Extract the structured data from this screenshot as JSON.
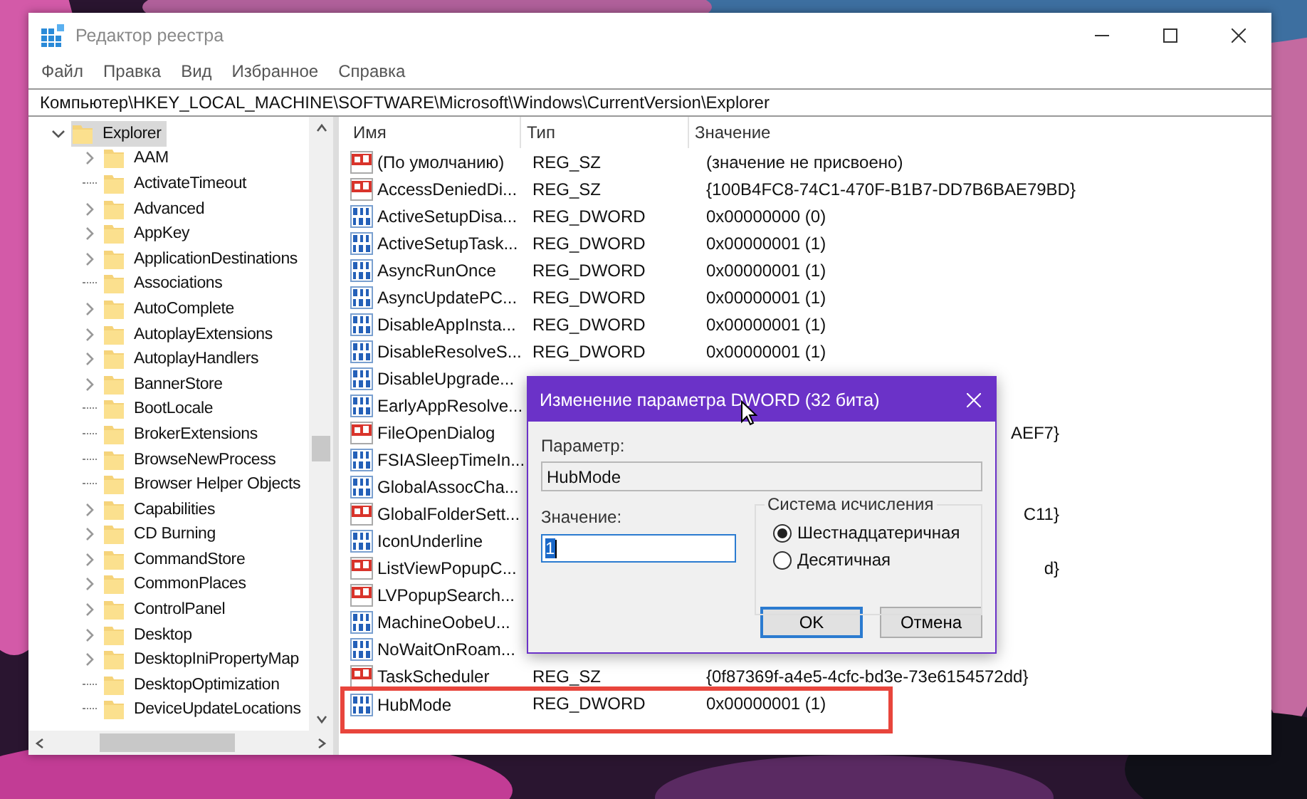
{
  "window": {
    "title": "Редактор реестра"
  },
  "menu": [
    "Файл",
    "Правка",
    "Вид",
    "Избранное",
    "Справка"
  ],
  "address": "Компьютер\\HKEY_LOCAL_MACHINE\\SOFTWARE\\Microsoft\\Windows\\CurrentVersion\\Explorer",
  "tree": [
    {
      "label": "Explorer",
      "expanded": true,
      "selected": true,
      "children": [
        {
          "label": "AAM",
          "expandable": true
        },
        {
          "label": "ActivateTimeout",
          "expandable": false
        },
        {
          "label": "Advanced",
          "expandable": true
        },
        {
          "label": "AppKey",
          "expandable": true
        },
        {
          "label": "ApplicationDestinations",
          "expandable": true
        },
        {
          "label": "Associations",
          "expandable": false
        },
        {
          "label": "AutoComplete",
          "expandable": true
        },
        {
          "label": "AutoplayExtensions",
          "expandable": true
        },
        {
          "label": "AutoplayHandlers",
          "expandable": true
        },
        {
          "label": "BannerStore",
          "expandable": true
        },
        {
          "label": "BootLocale",
          "expandable": false
        },
        {
          "label": "BrokerExtensions",
          "expandable": false
        },
        {
          "label": "BrowseNewProcess",
          "expandable": false
        },
        {
          "label": "Browser Helper Objects",
          "expandable": false
        },
        {
          "label": "Capabilities",
          "expandable": true
        },
        {
          "label": "CD Burning",
          "expandable": true
        },
        {
          "label": "CommandStore",
          "expandable": true
        },
        {
          "label": "CommonPlaces",
          "expandable": true
        },
        {
          "label": "ControlPanel",
          "expandable": true
        },
        {
          "label": "Desktop",
          "expandable": true
        },
        {
          "label": "DesktopIniPropertyMap",
          "expandable": true
        },
        {
          "label": "DesktopOptimization",
          "expandable": false
        },
        {
          "label": "DeviceUpdateLocations",
          "expandable": false
        }
      ]
    }
  ],
  "table": {
    "columns": [
      "Имя",
      "Тип",
      "Значение"
    ],
    "rows": [
      {
        "kind": "string",
        "name": "(По умолчанию)",
        "type": "REG_SZ",
        "value": "(значение не присвоено)"
      },
      {
        "kind": "string",
        "name": "AccessDeniedDi...",
        "type": "REG_SZ",
        "value": "{100B4FC8-74C1-470F-B1B7-DD7B6BAE79BD}"
      },
      {
        "kind": "binary",
        "name": "ActiveSetupDisa...",
        "type": "REG_DWORD",
        "value": "0x00000000 (0)"
      },
      {
        "kind": "binary",
        "name": "ActiveSetupTask...",
        "type": "REG_DWORD",
        "value": "0x00000001 (1)"
      },
      {
        "kind": "binary",
        "name": "AsyncRunOnce",
        "type": "REG_DWORD",
        "value": "0x00000001 (1)"
      },
      {
        "kind": "binary",
        "name": "AsyncUpdatePC...",
        "type": "REG_DWORD",
        "value": "0x00000001 (1)"
      },
      {
        "kind": "binary",
        "name": "DisableAppInsta...",
        "type": "REG_DWORD",
        "value": "0x00000001 (1)"
      },
      {
        "kind": "binary",
        "name": "DisableResolveS...",
        "type": "REG_DWORD",
        "value": "0x00000001 (1)"
      },
      {
        "kind": "binary",
        "name": "DisableUpgrade..."
      },
      {
        "kind": "binary",
        "name": "EarlyAppResolve..."
      },
      {
        "kind": "string",
        "name": "FileOpenDialog",
        "value_tail": "AEF7}"
      },
      {
        "kind": "binary",
        "name": "FSIASleepTimeIn..."
      },
      {
        "kind": "binary",
        "name": "GlobalAssocCha..."
      },
      {
        "kind": "string",
        "name": "GlobalFolderSett...",
        "value_tail": "C11}"
      },
      {
        "kind": "binary",
        "name": "IconUnderline"
      },
      {
        "kind": "string",
        "name": "ListViewPopupC...",
        "value_tail": "d}"
      },
      {
        "kind": "string",
        "name": "LVPopupSearch..."
      },
      {
        "kind": "binary",
        "name": "MachineOobeU..."
      },
      {
        "kind": "binary",
        "name": "NoWaitOnRoam..."
      },
      {
        "kind": "string",
        "name": "TaskScheduler",
        "type": "REG_SZ",
        "value": "{0f87369f-a4e5-4cfc-bd3e-73e6154572dd}"
      },
      {
        "kind": "binary",
        "name": "HubMode",
        "type": "REG_DWORD",
        "value": "0x00000001 (1)",
        "highlighted": true
      }
    ]
  },
  "dialog": {
    "title": "Изменение параметра DWORD (32 бита)",
    "param_label": "Параметр:",
    "param_value": "HubMode",
    "value_label": "Значение:",
    "value": "1",
    "group_title": "Система исчисления",
    "radios": [
      {
        "label": "Шестнадцатеричная",
        "selected": true
      },
      {
        "label": "Десятичная",
        "selected": false
      }
    ],
    "buttons": [
      "OK",
      "Отмена"
    ]
  }
}
